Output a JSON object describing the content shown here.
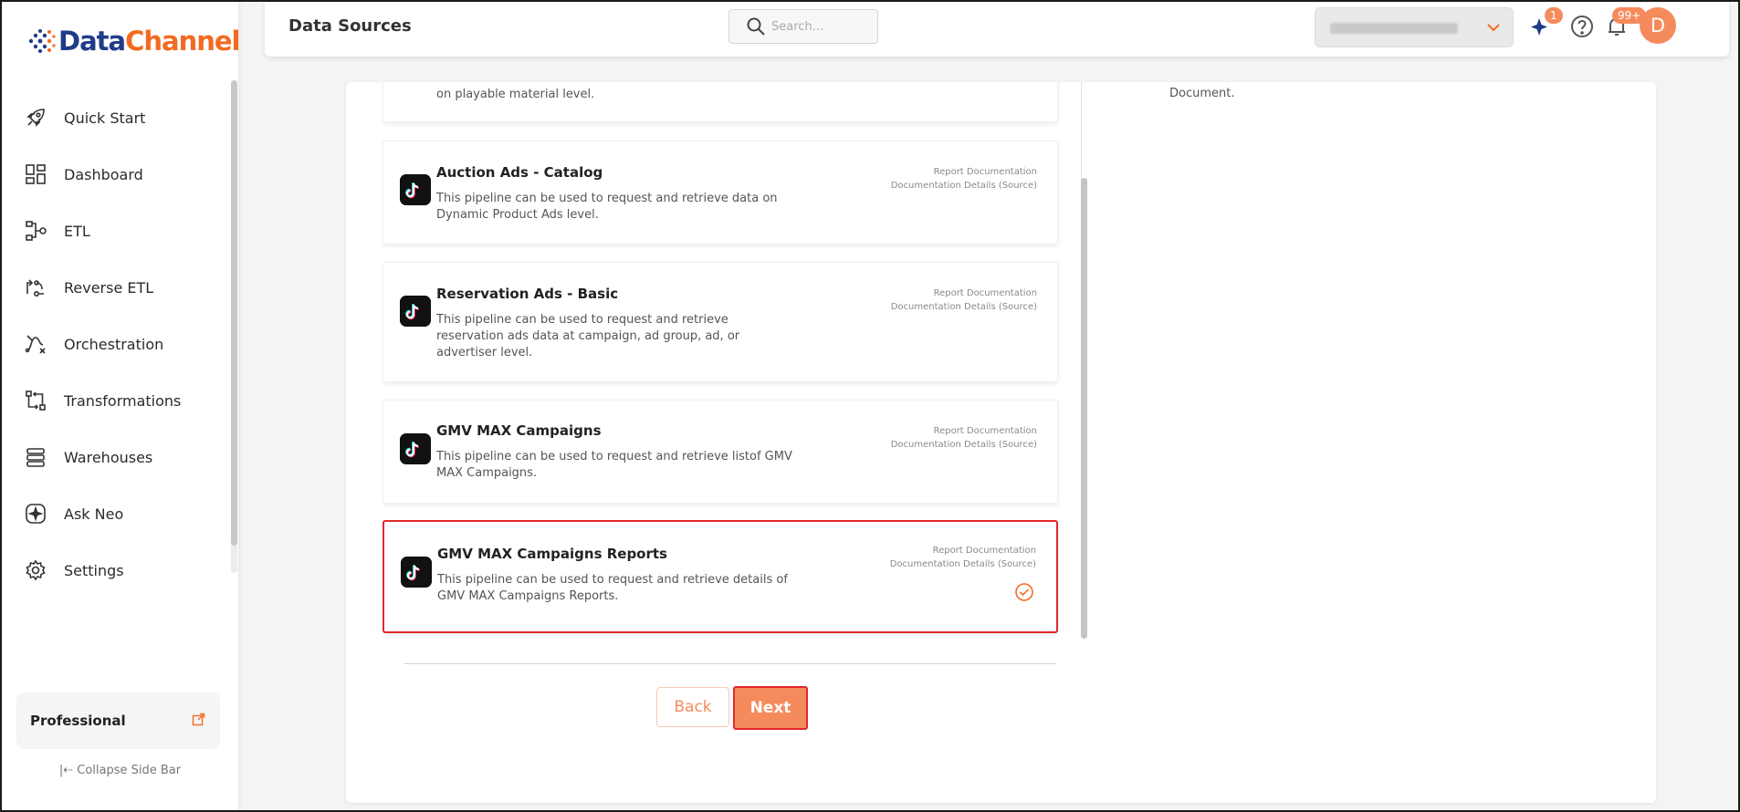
{
  "app": {
    "brand_part1": "Data",
    "brand_part2": "Channel",
    "brand_colors": {
      "primary": "#1f3c88",
      "accent": "#f26b21"
    }
  },
  "sidebar": {
    "items": [
      {
        "label": "Quick Start",
        "icon": "rocket-icon"
      },
      {
        "label": "Dashboard",
        "icon": "dashboard-icon"
      },
      {
        "label": "ETL",
        "icon": "etl-icon"
      },
      {
        "label": "Reverse ETL",
        "icon": "reverse-etl-icon"
      },
      {
        "label": "Orchestration",
        "icon": "orchestration-icon"
      },
      {
        "label": "Transformations",
        "icon": "transformations-icon"
      },
      {
        "label": "Warehouses",
        "icon": "warehouses-icon"
      },
      {
        "label": "Ask Neo",
        "icon": "ask-neo-icon"
      },
      {
        "label": "Settings",
        "icon": "settings-icon"
      }
    ],
    "plan": "Professional",
    "collapse_label": "Collapse Side Bar"
  },
  "header": {
    "title": "Data Sources",
    "search_placeholder": "Search...",
    "ai_badge": "1",
    "notifications_badge": "99+",
    "avatar_initial": "D",
    "accent_color": "#f58b5d"
  },
  "main": {
    "partial_top_desc": "on playable material level.",
    "right_panel_text": "Document.",
    "pipelines": [
      {
        "name": "Auction Ads - Catalog",
        "desc": "This pipeline can be used to request and retrieve data on Dynamic Product Ads level.",
        "link1": "Report Documentation",
        "link2": "Documentation Details (Source)",
        "selected": false
      },
      {
        "name": "Reservation Ads - Basic",
        "desc": "This pipeline can be used to request and retrieve reservation ads data at campaign, ad group, ad, or advertiser level.",
        "link1": "Report Documentation",
        "link2": "Documentation Details (Source)",
        "selected": false
      },
      {
        "name": "GMV MAX Campaigns",
        "desc": "This pipeline can be used to request and retrieve listof GMV MAX Campaigns.",
        "link1": "Report Documentation",
        "link2": "Documentation Details (Source)",
        "selected": false
      },
      {
        "name": "GMV MAX Campaigns Reports",
        "desc": "This pipeline can be used to request and retrieve details of GMV MAX Campaigns Reports.",
        "link1": "Report Documentation",
        "link2": "Documentation Details (Source)",
        "selected": true
      }
    ],
    "back_label": "Back",
    "next_label": "Next"
  }
}
